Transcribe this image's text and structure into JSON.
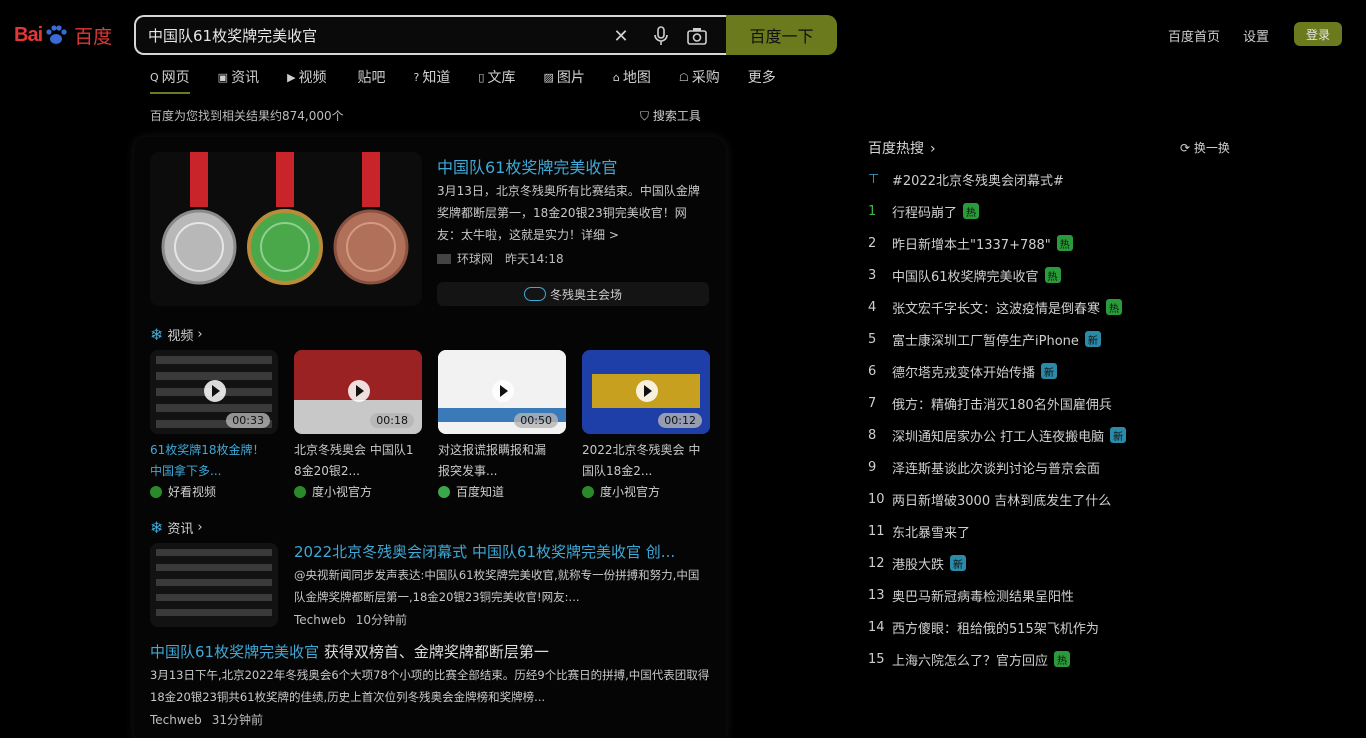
{
  "header": {
    "logo_left": "Bai",
    "logo_right": "百度",
    "search_value": "中国队61枚奖牌完美收官",
    "search_button": "百度一下",
    "links": [
      "百度首页",
      "设置"
    ],
    "login": "登录"
  },
  "tabs": [
    {
      "icon": "Q",
      "label": "网页"
    },
    {
      "icon": "▣",
      "label": "资讯"
    },
    {
      "icon": "▶",
      "label": "视频"
    },
    {
      "icon": "",
      "label": "贴吧"
    },
    {
      "icon": "?",
      "label": "知道"
    },
    {
      "icon": "▯",
      "label": "文库"
    },
    {
      "icon": "▨",
      "label": "图片"
    },
    {
      "icon": "⌂",
      "label": "地图"
    },
    {
      "icon": "☖",
      "label": "采购"
    },
    {
      "icon": "",
      "label": "更多"
    }
  ],
  "result_count": "百度为您找到相关结果约874,000个",
  "search_tools": "搜索工具",
  "top_news": {
    "title": "中国队61枚奖牌完美收官",
    "summary": "3月13日，北京冬残奥所有比赛结束。中国队金牌奖牌都断层第一，18金20银23铜完美收官！网友：太牛啦，这就是实力！详细 >",
    "source": "环球网",
    "time": "昨天14:18",
    "tag": "冬残奥主会场"
  },
  "video_section": {
    "heading": "视频",
    "items": [
      {
        "duration": "00:33",
        "title_a": "61枚奖牌18枚金牌！",
        "title_b": "中国拿下多...",
        "source": "好看视频"
      },
      {
        "duration": "00:18",
        "title_a": "北京冬残奥会 中国队1",
        "title_b": "8金20银2...",
        "source": "度小视官方"
      },
      {
        "duration": "00:50",
        "title_a": "对这报谎报瞒报和漏",
        "title_b": "报突发事...",
        "source": "百度知道"
      },
      {
        "duration": "00:12",
        "title_a": "2022北京冬残奥会 中",
        "title_b": "国队18金2...",
        "source": "度小视官方"
      }
    ]
  },
  "news_section": {
    "heading": "资讯",
    "item1": {
      "title": "2022北京冬残奥会闭幕式 中国队61枚奖牌完美收官 创...",
      "summary": "@央视新闻同步发声表达:中国队61枚奖牌完美收官,就称专一份拼搏和努力,中国队金牌奖牌都断层第一,18金20银23铜完美收官!网友:...",
      "source": "Techweb",
      "time": "10分钟前"
    },
    "item2": {
      "title_a": "中国队61枚奖牌完美收官",
      "title_b": " 获得双榜首、金牌奖牌都断层第一",
      "summary": "3月13日下午,北京2022年冬残奥会6个大项78个小项的比赛全部结束。历经9个比赛日的拼搏,中国代表团取得18金20银23铜共61枚奖牌的佳绩,历史上首次位列冬残奥会金牌榜和奖牌榜...",
      "source": "Techweb",
      "time": "31分钟前"
    }
  },
  "hot": {
    "heading": "百度热搜",
    "refresh": "换一换",
    "items": [
      {
        "num": "⊤",
        "text": "#2022北京冬残奥会闭幕式#",
        "badge": ""
      },
      {
        "num": "1",
        "text": "行程码崩了",
        "badge": "热"
      },
      {
        "num": "2",
        "text": "昨日新增本土\"1337+788\"",
        "badge": "热"
      },
      {
        "num": "3",
        "text": "中国队61枚奖牌完美收官",
        "badge": "热"
      },
      {
        "num": "4",
        "text": "张文宏千字长文：这波疫情是倒春寒",
        "badge": "热"
      },
      {
        "num": "5",
        "text": "富士康深圳工厂暂停生产iPhone",
        "badge": "新"
      },
      {
        "num": "6",
        "text": "德尔塔克戎变体开始传播",
        "badge": "新"
      },
      {
        "num": "7",
        "text": "俄方：精确打击消灭180名外国雇佣兵",
        "badge": ""
      },
      {
        "num": "8",
        "text": "深圳通知居家办公 打工人连夜搬电脑",
        "badge": "新"
      },
      {
        "num": "9",
        "text": "泽连斯基谈此次谈判讨论与普京会面",
        "badge": ""
      },
      {
        "num": "10",
        "text": "两日新增破3000 吉林到底发生了什么",
        "badge": ""
      },
      {
        "num": "11",
        "text": "东北暴雪来了",
        "badge": ""
      },
      {
        "num": "12",
        "text": "港股大跌",
        "badge": "新"
      },
      {
        "num": "13",
        "text": "奥巴马新冠病毒检测结果呈阳性",
        "badge": ""
      },
      {
        "num": "14",
        "text": "西方傻眼：租给俄的515架飞机作为",
        "badge": ""
      },
      {
        "num": "15",
        "text": "上海六院怎么了？官方回应",
        "badge": "热"
      }
    ]
  },
  "colors": {
    "accent": "#6a7a1d",
    "link": "#3fa8d6",
    "bg": "#000000"
  }
}
